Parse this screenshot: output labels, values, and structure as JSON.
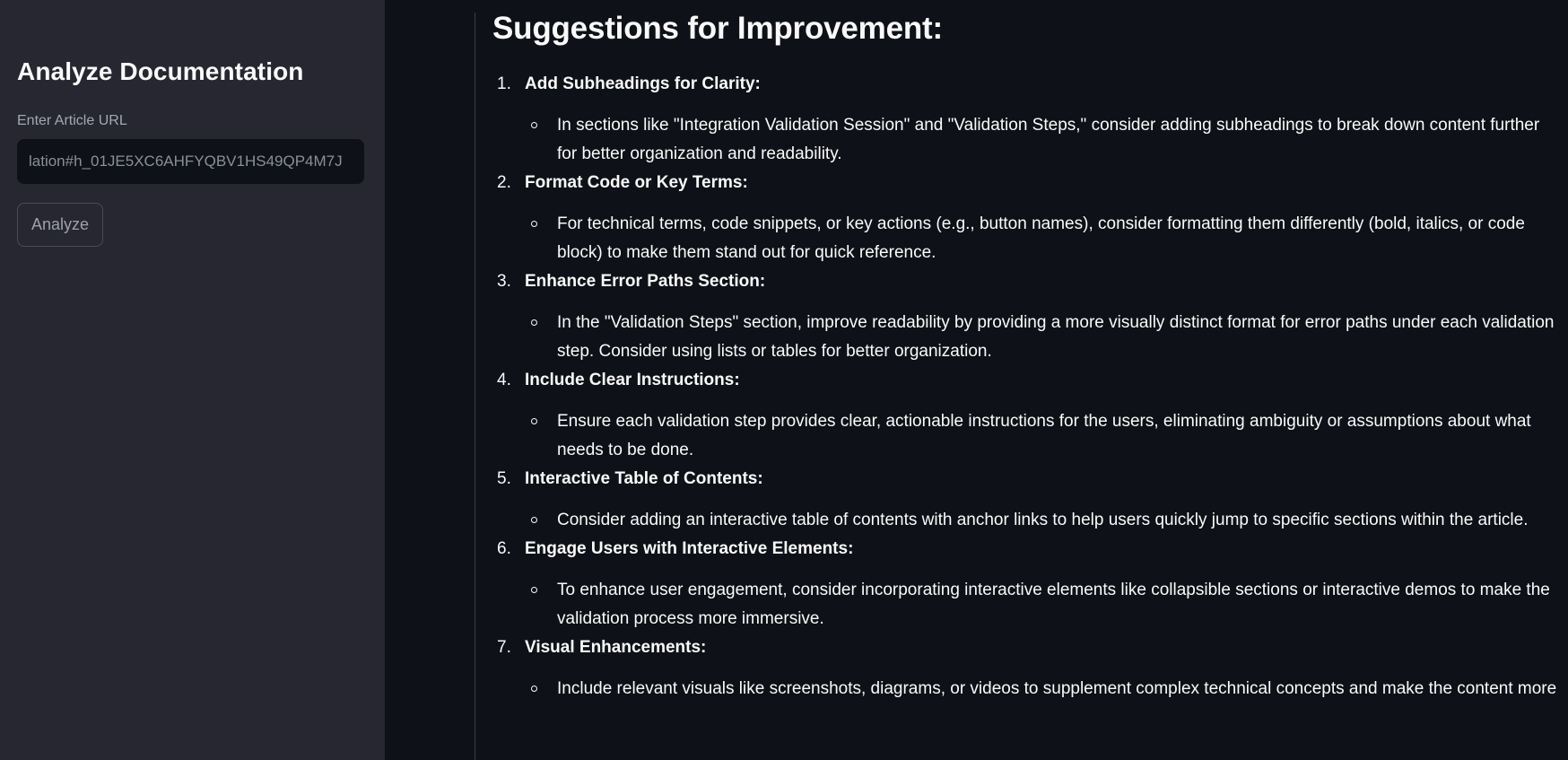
{
  "sidebar": {
    "title": "Analyze Documentation",
    "url_label": "Enter Article URL",
    "url_value": "lation#h_01JE5XC6AHFYQBV1HS49QP4M7J",
    "analyze_label": "Analyze"
  },
  "main": {
    "heading": "Suggestions for Improvement:",
    "suggestions": [
      {
        "number": "1.",
        "title": "Add Subheadings for Clarity:",
        "detail": "In sections like \"Integration Validation Session\" and \"Validation Steps,\" consider adding subheadings to break down content further for better organization and readability."
      },
      {
        "number": "2.",
        "title": "Format Code or Key Terms:",
        "detail": "For technical terms, code snippets, or key actions (e.g., button names), consider formatting them differently (bold, italics, or code block) to make them stand out for quick reference."
      },
      {
        "number": "3.",
        "title": "Enhance Error Paths Section:",
        "detail": "In the \"Validation Steps\" section, improve readability by providing a more visually distinct format for error paths under each validation step. Consider using lists or tables for better organization."
      },
      {
        "number": "4.",
        "title": "Include Clear Instructions:",
        "detail": "Ensure each validation step provides clear, actionable instructions for the users, eliminating ambiguity or assumptions about what needs to be done."
      },
      {
        "number": "5.",
        "title": "Interactive Table of Contents:",
        "detail": "Consider adding an interactive table of contents with anchor links to help users quickly jump to specific sections within the article."
      },
      {
        "number": "6.",
        "title": "Engage Users with Interactive Elements:",
        "detail": "To enhance user engagement, consider incorporating interactive elements like collapsible sections or interactive demos to make the validation process more immersive."
      },
      {
        "number": "7.",
        "title": "Visual Enhancements:",
        "detail": "Include relevant visuals like screenshots, diagrams, or videos to supplement complex technical concepts and make the content more"
      }
    ]
  }
}
